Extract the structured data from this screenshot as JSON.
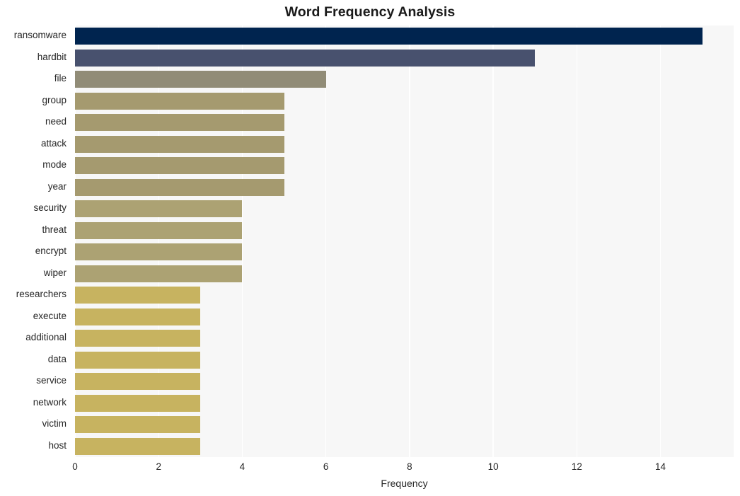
{
  "chart_data": {
    "type": "bar",
    "orientation": "horizontal",
    "title": "Word Frequency Analysis",
    "xlabel": "Frequency",
    "ylabel": "",
    "xlim": [
      0,
      15.75
    ],
    "ylim": [
      0,
      20
    ],
    "grid": true,
    "legend": null,
    "xticks": [
      "0",
      "2",
      "4",
      "6",
      "8",
      "10",
      "12",
      "14"
    ],
    "xtick_values": [
      0,
      2,
      4,
      6,
      8,
      10,
      12,
      14
    ],
    "categories": [
      "ransomware",
      "hardbit",
      "file",
      "group",
      "need",
      "attack",
      "mode",
      "year",
      "security",
      "threat",
      "encrypt",
      "wiper",
      "researchers",
      "execute",
      "additional",
      "data",
      "service",
      "network",
      "victim",
      "host"
    ],
    "values": [
      15,
      11,
      6,
      5,
      5,
      5,
      5,
      5,
      4,
      4,
      4,
      4,
      3,
      3,
      3,
      3,
      3,
      3,
      3,
      3
    ],
    "bar_colors": [
      "#00244f",
      "#48516e",
      "#918c77",
      "#a59a6f",
      "#a59a6f",
      "#a59a6f",
      "#a59a6f",
      "#a59a6f",
      "#aca273",
      "#aca273",
      "#aca273",
      "#aca273",
      "#c7b360",
      "#c7b360",
      "#c7b360",
      "#c7b360",
      "#c7b360",
      "#c7b360",
      "#c7b360",
      "#c7b360"
    ]
  },
  "style": {
    "plot_background": "#f7f7f7",
    "figure_background": "#ffffff",
    "gridline_color": "#ffffff",
    "text_color": "#262626"
  }
}
